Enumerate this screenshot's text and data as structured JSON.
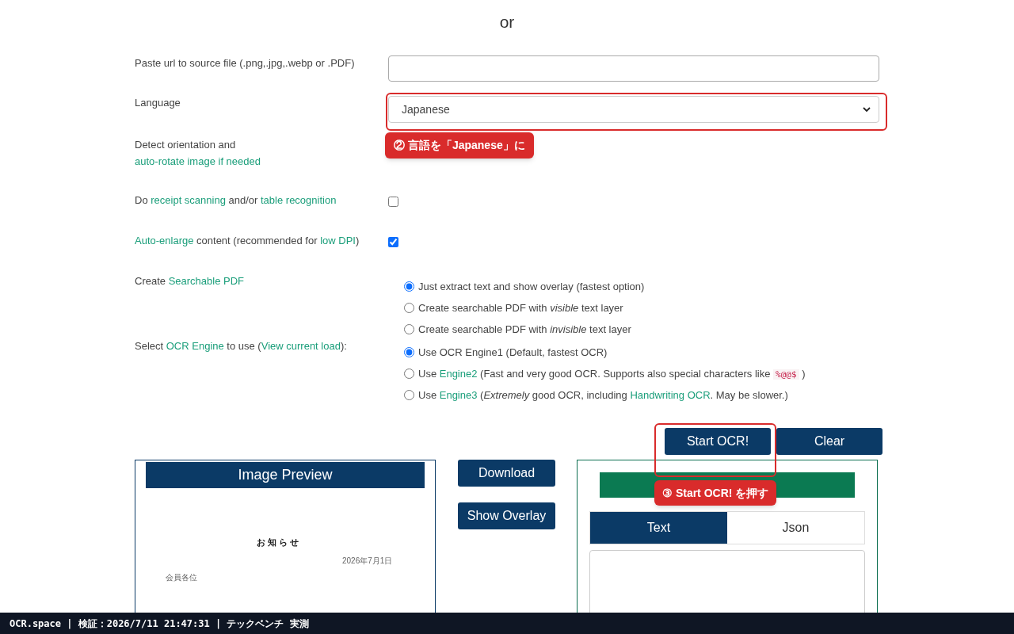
{
  "divider_text": "or",
  "rows": [
    {
      "kind": "url",
      "label": [
        {
          "kind": "text",
          "text": "Paste url to source file (.png,.jpg,.webp or .PDF)"
        }
      ]
    },
    {
      "kind": "select",
      "label": [
        {
          "kind": "text",
          "text": "Language"
        }
      ],
      "value": "Japanese"
    },
    {
      "kind": "note",
      "label": [
        {
          "kind": "text",
          "text": "Detect orientation and "
        },
        {
          "kind": "link",
          "text": "auto-rotate image if needed"
        }
      ]
    },
    {
      "kind": "checkbox",
      "label": [
        {
          "kind": "text",
          "text": "Do "
        },
        {
          "kind": "link",
          "text": "receipt scanning"
        },
        {
          "kind": "text",
          "text": " and/or "
        },
        {
          "kind": "link",
          "text": "table recognition"
        }
      ],
      "checked": false
    },
    {
      "kind": "checkbox",
      "label": [
        {
          "kind": "link",
          "text": "Auto-enlarge"
        },
        {
          "kind": "text",
          "text": " content (recommended for "
        },
        {
          "kind": "link",
          "text": "low DPI"
        },
        {
          "kind": "text",
          "text": ")"
        }
      ],
      "checked": true
    },
    {
      "kind": "radios",
      "label": [
        {
          "kind": "text",
          "text": "Create "
        },
        {
          "kind": "link",
          "text": "Searchable PDF"
        }
      ],
      "options": [
        {
          "selected": true,
          "segments": [
            {
              "kind": "text",
              "text": "Just extract text and show overlay (fastest option)"
            }
          ]
        },
        {
          "selected": false,
          "segments": [
            {
              "kind": "text",
              "text": "Create searchable PDF with "
            },
            {
              "kind": "italic",
              "text": "visible"
            },
            {
              "kind": "text",
              "text": " text layer"
            }
          ]
        },
        {
          "selected": false,
          "segments": [
            {
              "kind": "text",
              "text": "Create searchable PDF with "
            },
            {
              "kind": "italic",
              "text": "invisible"
            },
            {
              "kind": "text",
              "text": " text layer"
            }
          ]
        }
      ]
    },
    {
      "kind": "radios",
      "label": [
        {
          "kind": "text",
          "text": "Select "
        },
        {
          "kind": "link",
          "text": "OCR Engine"
        },
        {
          "kind": "text",
          "text": " to use ("
        },
        {
          "kind": "link",
          "text": "View current load"
        },
        {
          "kind": "text",
          "text": "):"
        }
      ],
      "options": [
        {
          "selected": true,
          "segments": [
            {
              "kind": "text",
              "text": "Use OCR Engine1 (Default, fastest OCR)"
            }
          ]
        },
        {
          "selected": false,
          "segments": [
            {
              "kind": "text",
              "text": "Use "
            },
            {
              "kind": "link",
              "text": "Engine2"
            },
            {
              "kind": "text",
              "text": " (Fast and very good OCR. Supports also special characters like "
            },
            {
              "kind": "code",
              "text": "%@@$"
            },
            {
              "kind": "text",
              "text": " )"
            }
          ]
        },
        {
          "selected": false,
          "segments": [
            {
              "kind": "text",
              "text": "Use "
            },
            {
              "kind": "link",
              "text": "Engine3"
            },
            {
              "kind": "text",
              "text": " ("
            },
            {
              "kind": "italic",
              "text": "Extremely"
            },
            {
              "kind": "text",
              "text": " good OCR, including "
            },
            {
              "kind": "link",
              "text": "Handwriting OCR"
            },
            {
              "kind": "text",
              "text": ". May be slower.)"
            }
          ]
        }
      ]
    }
  ],
  "actions": [
    "Start OCR!",
    "Clear"
  ],
  "preview": {
    "title": "Image Preview",
    "document": {
      "heading": "お 知 ら せ",
      "date": "2026年7月1日",
      "salutation": "会員各位"
    }
  },
  "preview_buttons": [
    "Download",
    "Show Overlay"
  ],
  "result": {
    "tabs": [
      {
        "label": "Text",
        "selected": true
      },
      {
        "label": "Json",
        "selected": false
      }
    ]
  },
  "annotations": [
    {
      "text": "② 言語を「Japanese」に"
    },
    {
      "text": "③ Start OCR! を押す"
    }
  ],
  "status_bar": "OCR.space | 検証：2026/7/11 21:47:31 | テックベンチ 実測"
}
